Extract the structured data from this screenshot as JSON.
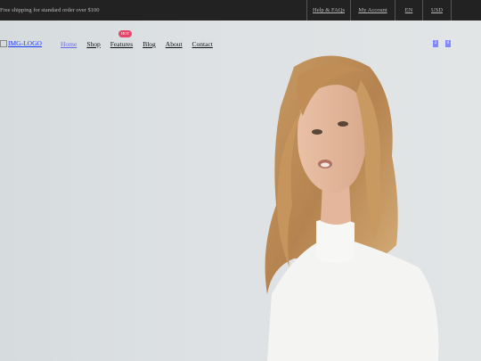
{
  "topbar": {
    "shipping_text": "Free shipping for standard order over $100",
    "links": [
      "Help & FAQs",
      "My Account",
      "EN",
      "USD"
    ]
  },
  "header": {
    "logo_alt": "IMG-LOGO",
    "nav": [
      "Home",
      "Shop",
      "Features",
      "Blog",
      "About",
      "Contact"
    ],
    "badge": "HOT",
    "icons": [
      "search-icon",
      "cart-icon"
    ],
    "icon_counts": [
      "2",
      "0"
    ]
  },
  "colors": {
    "topbar_bg": "#222222",
    "nav_active": "#6a6ae6",
    "badge_bg": "#e8456b",
    "hero_bg": "#dfe3e5"
  }
}
